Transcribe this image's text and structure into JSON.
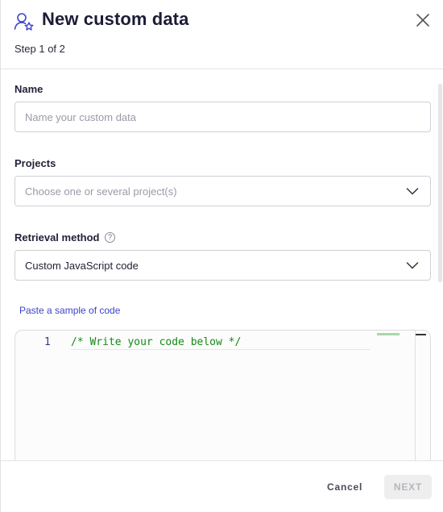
{
  "header": {
    "title": "New custom data",
    "step": "Step 1 of 2",
    "icon": "user-star-icon",
    "close_icon": "close-icon"
  },
  "form": {
    "name": {
      "label": "Name",
      "placeholder": "Name your custom data",
      "value": ""
    },
    "projects": {
      "label": "Projects",
      "placeholder": "Choose one or several project(s)"
    },
    "retrieval": {
      "label": "Retrieval method",
      "help_glyph": "?",
      "value": "Custom JavaScript code"
    },
    "paste_link": "Paste a sample of code"
  },
  "editor": {
    "line_number": "1",
    "code": "/* Write your code below */"
  },
  "footer": {
    "cancel": "Cancel",
    "next": "NEXT"
  },
  "colors": {
    "accent": "#3a44c8",
    "code_comment": "#138a13",
    "disabled_text": "#b6b6bc"
  }
}
